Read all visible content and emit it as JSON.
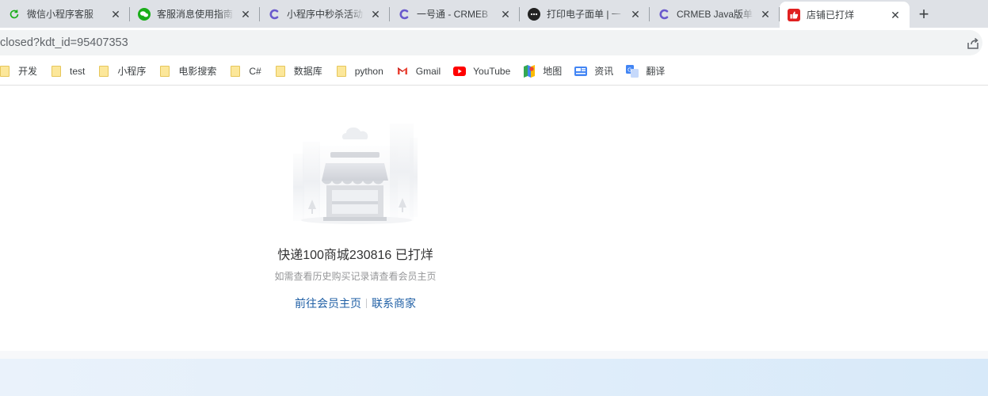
{
  "tabs": [
    {
      "title": "微信小程序客服",
      "icon": "refresh-green-icon",
      "active": false
    },
    {
      "title": "客服消息使用指南",
      "icon": "wechat-icon",
      "active": false
    },
    {
      "title": "小程序中秒杀活动",
      "icon": "crmeb-icon",
      "active": false
    },
    {
      "title": "一号通 - CRMEB",
      "icon": "crmeb-icon",
      "active": false
    },
    {
      "title": "打印电子面单 | 一",
      "icon": "dark-circle-icon",
      "active": false
    },
    {
      "title": "CRMEB Java版单",
      "icon": "crmeb-icon",
      "active": false
    },
    {
      "title": "店铺已打烊",
      "icon": "youzan-thumb-icon",
      "active": true
    }
  ],
  "new_tab_label": "+",
  "close_glyph": "✕",
  "address": {
    "url": "closed?kdt_id=95407353"
  },
  "bookmarks": [
    {
      "label": "开发",
      "icon": "folder-icon"
    },
    {
      "label": "test",
      "icon": "folder-icon"
    },
    {
      "label": "小程序",
      "icon": "folder-icon"
    },
    {
      "label": "电影搜索",
      "icon": "folder-icon"
    },
    {
      "label": "C#",
      "icon": "folder-icon"
    },
    {
      "label": "数据库",
      "icon": "folder-icon"
    },
    {
      "label": "python",
      "icon": "folder-icon"
    },
    {
      "label": "Gmail",
      "icon": "gmail-icon"
    },
    {
      "label": "YouTube",
      "icon": "youtube-icon"
    },
    {
      "label": "地图",
      "icon": "maps-icon"
    },
    {
      "label": "资讯",
      "icon": "news-icon"
    },
    {
      "label": "翻译",
      "icon": "translate-icon"
    }
  ],
  "page": {
    "title": "快递100商城230816 已打烊",
    "subtitle": "如需查看历史购买记录请查看会员主页",
    "link_member": "前往会员主页",
    "link_contact": "联系商家"
  },
  "colors": {
    "link": "#1f5fa5",
    "title": "#323233",
    "subtitle": "#969799"
  }
}
